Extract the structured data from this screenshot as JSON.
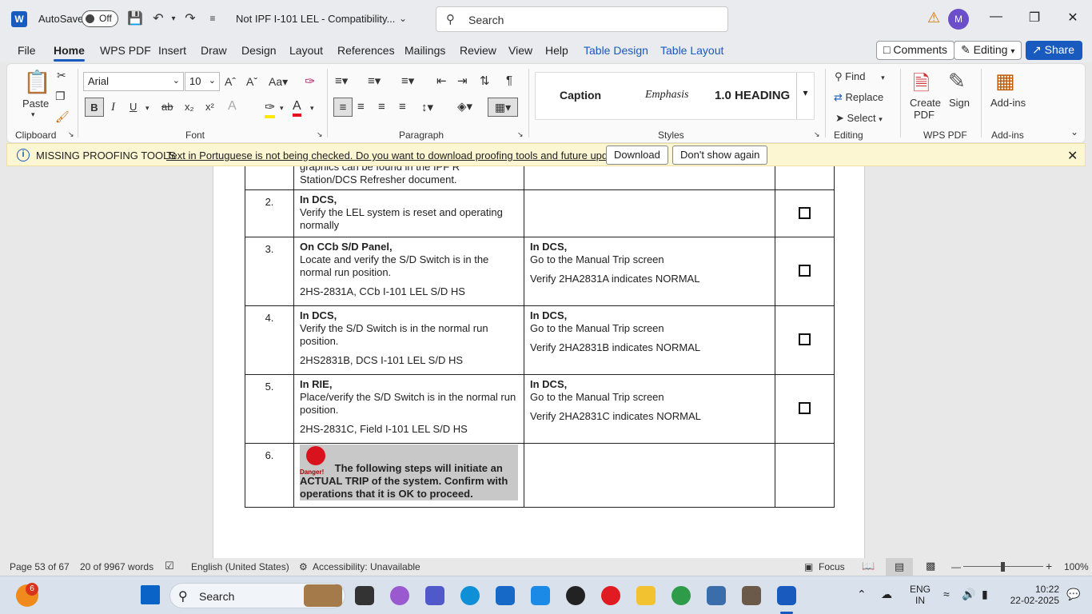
{
  "titlebar": {
    "app_letter": "W",
    "autosave_label": "AutoSave",
    "autosave_state": "Off",
    "doc_title": "Not IPF I-101 LEL  -  Compatibility...",
    "search_placeholder": "Search",
    "avatar_initial": "M"
  },
  "tabs": [
    "File",
    "Home",
    "WPS PDF",
    "Insert",
    "Draw",
    "Design",
    "Layout",
    "References",
    "Mailings",
    "Review",
    "View",
    "Help",
    "Table Design",
    "Table Layout"
  ],
  "active_tab": "Home",
  "header_buttons": {
    "comments": "Comments",
    "editing": "Editing",
    "share": "Share"
  },
  "ribbon": {
    "clipboard": {
      "label": "Clipboard",
      "paste": "Paste"
    },
    "font": {
      "label": "Font",
      "font_name": "Arial",
      "font_size": "10",
      "bold": "B",
      "italic": "I",
      "underline": "U",
      "strike": "ab",
      "sub": "x₂",
      "sup": "x²"
    },
    "paragraph": {
      "label": "Paragraph"
    },
    "styles": {
      "label": "Styles",
      "items": [
        "Caption",
        "Emphasis",
        "1.0  HEADING"
      ]
    },
    "editing": {
      "label": "Editing",
      "find": "Find",
      "replace": "Replace",
      "select": "Select"
    },
    "wps_pdf": {
      "label": "WPS PDF",
      "create_pdf": "Create PDF",
      "sign": "Sign"
    },
    "addins": {
      "label": "Add-ins",
      "addins": "Add-ins"
    }
  },
  "infobar": {
    "title": "MISSING PROOFING TOOLS",
    "message": "Text in Portuguese is not being checked. Do you want to download proofing tools and future updates?",
    "download": "Download",
    "dont_show": "Don't show again"
  },
  "document": {
    "top_row": {
      "line1": "graphics can be found in the IPF R",
      "line2": "Station/DCS Refresher document."
    },
    "rows": [
      {
        "num": "2.",
        "step_head": "In DCS,",
        "step_body": "Verify the LEL system is reset and operating normally",
        "step_tag": "",
        "verify_head": "",
        "verify_body": "",
        "verify_tag": "",
        "checkbox": true
      },
      {
        "num": "3.",
        "step_head": "On CCb S/D Panel,",
        "step_body": "Locate and verify the S/D Switch is in the normal run position.",
        "step_tag": "2HS-2831A, CCb I-101 LEL S/D HS",
        "verify_head": "In DCS,",
        "verify_body": "Go to the Manual Trip screen",
        "verify_tag": "Verify 2HA2831A indicates NORMAL",
        "checkbox": true
      },
      {
        "num": "4.",
        "step_head": "In DCS,",
        "step_body": "Verify the S/D Switch is in the normal run position.",
        "step_tag": "2HS2831B, DCS I-101 LEL S/D HS",
        "verify_head": "In DCS,",
        "verify_body": "Go to the Manual Trip screen",
        "verify_tag": "Verify 2HA2831B indicates NORMAL",
        "checkbox": true
      },
      {
        "num": "5.",
        "step_head": "In RIE,",
        "step_body": "Place/verify the S/D Switch is in the normal run position.",
        "step_tag": "2HS-2831C, Field I-101 LEL S/D HS",
        "verify_head": "In DCS,",
        "verify_body": "Go to the Manual Trip screen",
        "verify_tag": "Verify 2HA2831C indicates NORMAL",
        "checkbox": true
      }
    ],
    "danger_row": {
      "num": "6.",
      "sign_label": "Danger!",
      "text": "The following steps will initiate an ACTUAL TRIP of the system. Confirm with operations that it is OK to proceed."
    }
  },
  "statusbar": {
    "page": "Page 53 of 67",
    "words": "20 of 9967 words",
    "language": "English (United States)",
    "accessibility": "Accessibility: Unavailable",
    "focus": "Focus",
    "zoom": "100%"
  },
  "taskbar": {
    "notif_count": "6",
    "search_placeholder": "Search",
    "lang_line1": "ENG",
    "lang_line2": "IN",
    "time": "10:22",
    "date": "22-02-2025"
  },
  "colors": {
    "accent": "#185abd",
    "infobar_bg": "#fcf6d2",
    "danger": "#d8131d"
  }
}
